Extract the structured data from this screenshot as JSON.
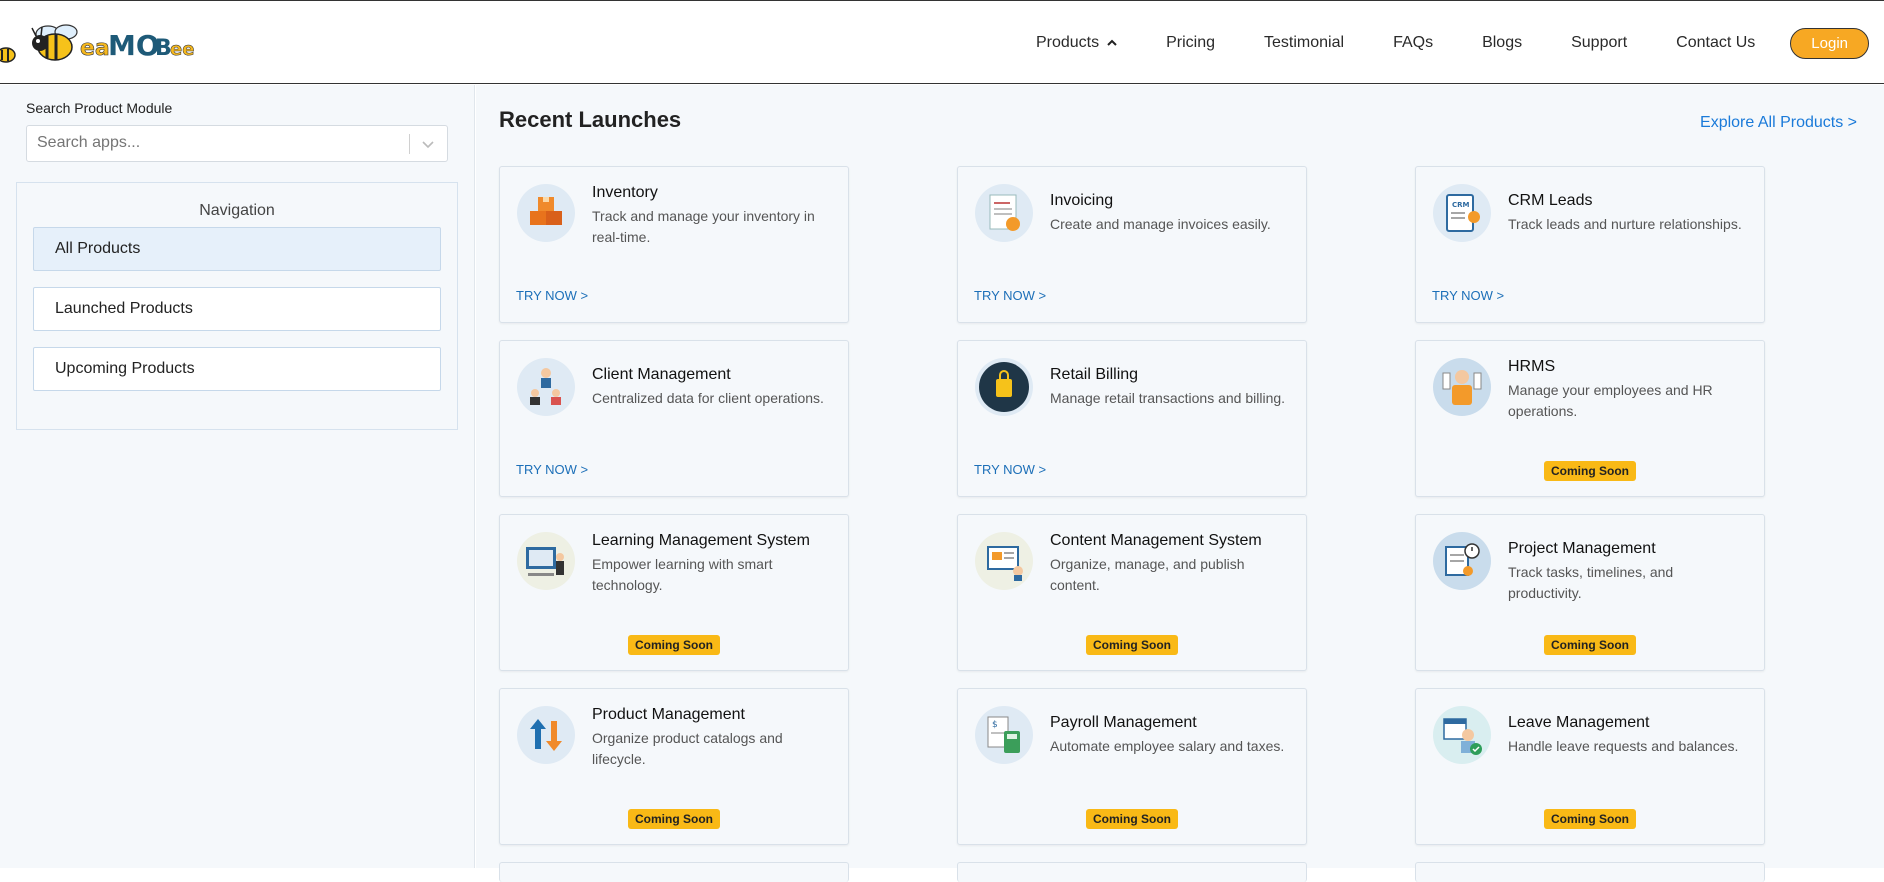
{
  "header": {
    "logo": {
      "brand": "eaMOBee"
    },
    "nav": [
      {
        "label": "Products"
      },
      {
        "label": "Pricing"
      },
      {
        "label": "Testimonial"
      },
      {
        "label": "FAQs"
      },
      {
        "label": "Blogs"
      },
      {
        "label": "Support"
      },
      {
        "label": "Contact Us"
      }
    ],
    "login_label": "Login"
  },
  "sidebar": {
    "search_label": "Search Product Module",
    "search_placeholder": "Search apps...",
    "navigation_title": "Navigation",
    "items": [
      {
        "label": "All Products",
        "active": true
      },
      {
        "label": "Launched Products",
        "active": false
      },
      {
        "label": "Upcoming Products",
        "active": false
      }
    ]
  },
  "main": {
    "title": "Recent Launches",
    "explore_label": "Explore All Products >",
    "try_label": "TRY NOW >",
    "soon_label": "Coming Soon",
    "cards": [
      {
        "title": "Inventory",
        "desc": "Track and manage your inventory in real-time.",
        "status": "try",
        "icon": "inventory-boxes-icon"
      },
      {
        "title": "Invoicing",
        "desc": "Create and manage invoices easily.",
        "status": "try",
        "icon": "invoice-icon"
      },
      {
        "title": "CRM Leads",
        "desc": "Track leads and nurture relationships.",
        "status": "try",
        "icon": "crm-clipboard-icon"
      },
      {
        "title": "Client Management",
        "desc": "Centralized data for client operations.",
        "status": "try",
        "icon": "client-people-icon"
      },
      {
        "title": "Retail Billing",
        "desc": "Manage retail transactions and billing.",
        "status": "try",
        "icon": "retail-bag-icon"
      },
      {
        "title": "HRMS",
        "desc": "Manage your employees and HR operations.",
        "status": "soon",
        "icon": "hr-person-icon"
      },
      {
        "title": "Learning Management System",
        "desc": "Empower learning with smart technology.",
        "status": "soon",
        "icon": "learning-icon"
      },
      {
        "title": "Content Management System",
        "desc": "Organize, manage, and publish content.",
        "status": "soon",
        "icon": "cms-icon"
      },
      {
        "title": "Project Management",
        "desc": "Track tasks, timelines, and productivity.",
        "status": "soon",
        "icon": "project-clock-icon"
      },
      {
        "title": "Product Management",
        "desc": "Organize product catalogs and lifecycle.",
        "status": "soon",
        "icon": "product-arrows-icon"
      },
      {
        "title": "Payroll Management",
        "desc": "Automate employee salary and taxes.",
        "status": "soon",
        "icon": "payroll-calculator-icon"
      },
      {
        "title": "Leave Management",
        "desc": "Handle leave requests and balances.",
        "status": "soon",
        "icon": "leave-calendar-icon"
      }
    ]
  },
  "colors": {
    "accent": "#f7a823",
    "link": "#1a7ad9",
    "badge": "#f9b916",
    "background": "#f5f8fb"
  }
}
